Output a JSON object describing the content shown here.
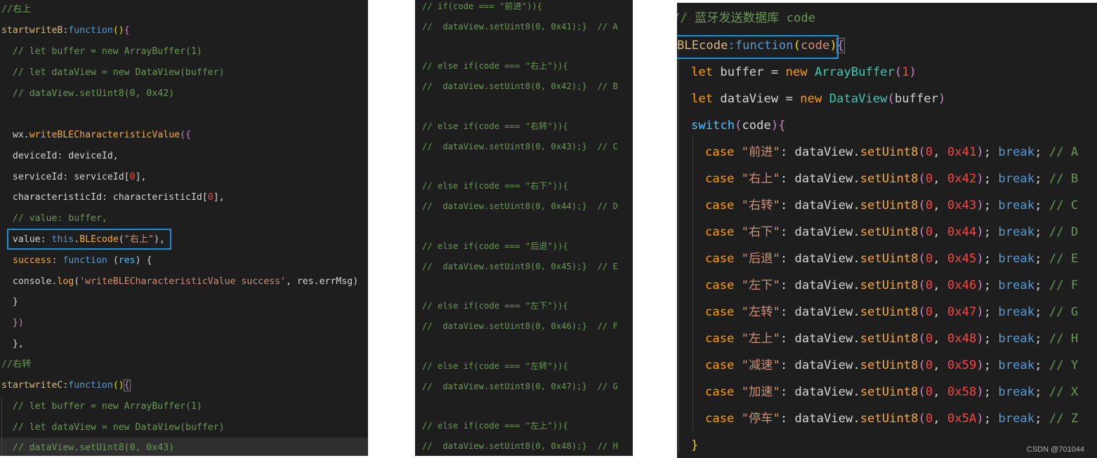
{
  "panel1": {
    "lines": [
      "//右上",
      "startwriteB:function(){",
      "  // let buffer = new ArrayBuffer(1)",
      "  // let dataView = new DataView(buffer)",
      "  // dataView.setUint8(0, 0x42)",
      "",
      "  wx.writeBLECharacteristicValue({",
      "  deviceId: deviceId,",
      "  serviceId: serviceId[0],",
      "  characteristicId: characteristicId[0],",
      "  // value: buffer,",
      "  value: this.BLEcode(\"右上\"),",
      "  success: function (res) {",
      "  console.log('writeBLECharacteristicValue success', res.errMsg)",
      "  }",
      "  })",
      "  },",
      "//右转",
      "startwriteC:function(){",
      "  // let buffer = new ArrayBuffer(1)",
      "  // let dataView = new DataView(buffer)",
      "  // dataView.setUint8(0, 0x43)"
    ]
  },
  "panel2": {
    "lines": [
      "// if(code === \"前进\")){",
      "//  dataView.setUint8(0, 0x41);}  // A",
      "",
      "// else if(code === \"右上\")){",
      "//  dataView.setUint8(0, 0x42);}  // B",
      "",
      "// else if(code === \"右转\")){",
      "//  dataView.setUint8(0, 0x43);}  // C",
      "",
      "// else if(code === \"右下\")){",
      "//  dataView.setUint8(0, 0x44);}  // D",
      "",
      "// else if(code === \"后退\")){",
      "//  dataView.setUint8(0, 0x45);}  // E",
      "",
      "// else if(code === \"左下\")){",
      "//  dataView.setUint8(0, 0x46);}  // F",
      "",
      "// else if(code === \"左转\")){",
      "//  dataView.setUint8(0, 0x47);}  // G",
      "",
      "// else if(code === \"左上\")){",
      "//  dataView.setUint8(0, 0x48);}  // H"
    ]
  },
  "panel3": {
    "comment": "// 蓝牙发送数据库 code",
    "func_name": "BLEcode",
    "func_kw": ":function",
    "param": "code",
    "let_kw": "let",
    "new_kw": "new",
    "buffer_var": "buffer",
    "dataview_var": "dataView",
    "arraybuffer_cls": "ArrayBuffer",
    "dataview_cls": "DataView",
    "one": "1",
    "switch_kw": "switch",
    "case_kw": "case",
    "break_kw": "break",
    "method": "setUint8",
    "zero": "0",
    "cases": [
      {
        "label": "\"前进\"",
        "hex": "0x41",
        "letter": "// A"
      },
      {
        "label": "\"右上\"",
        "hex": "0x42",
        "letter": "// B"
      },
      {
        "label": "\"右转\"",
        "hex": "0x43",
        "letter": "// C"
      },
      {
        "label": "\"右下\"",
        "hex": "0x44",
        "letter": "// D"
      },
      {
        "label": "\"后退\"",
        "hex": "0x45",
        "letter": "// E"
      },
      {
        "label": "\"左下\"",
        "hex": "0x46",
        "letter": "// F"
      },
      {
        "label": "\"左转\"",
        "hex": "0x47",
        "letter": "// G"
      },
      {
        "label": "\"左上\"",
        "hex": "0x48",
        "letter": "// H"
      },
      {
        "label": "\"减速\"",
        "hex": "0x59",
        "letter": "// Y"
      },
      {
        "label": "\"加速\"",
        "hex": "0x58",
        "letter": "// X"
      },
      {
        "label": "\"停车\"",
        "hex": "0x5A",
        "letter": "// Z"
      }
    ],
    "closing": "}"
  },
  "watermark": "CSDN @701044"
}
